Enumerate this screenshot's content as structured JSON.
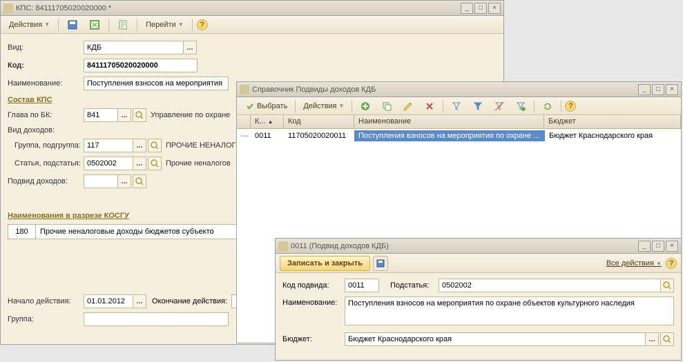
{
  "main_window": {
    "title": "КПС: 84111705020020000 *",
    "toolbar": {
      "actions": "Действия",
      "goto": "Перейти"
    },
    "fields": {
      "vid_label": "Вид:",
      "vid_value": "КДБ",
      "kod_label": "Код:",
      "kod_value": "84111705020020000",
      "naim_label": "Наименование:",
      "naim_value": "Поступления взносов на мероприятия"
    },
    "section_sostav": "Состав КПС",
    "glava_label": "Глава по БК:",
    "glava_value": "841",
    "glava_desc": "Управление по охране",
    "vid_dohodov_label": "Вид доходов:",
    "gruppa_label": "Группа, подгруппа:",
    "gruppa_value": "117",
    "gruppa_desc": "ПРОЧИЕ НЕНАЛОГ",
    "statya_label": "Статья, подстатья:",
    "statya_value": "0502002",
    "statya_desc": "Прочие неналогов",
    "podvid_label": "Подвид доходов:",
    "podvid_value": "",
    "section_kosgu": "Наименования в разрезе КОСГУ",
    "kosgu_code": "180",
    "kosgu_text": "Прочие неналоговые доходы бюджетов субъекто",
    "nachalo_label": "Начало действия:",
    "nachalo_value": "01.01.2012",
    "okonch_label": "Окончание действия:",
    "okonch_value": "",
    "group_label": "Группа:"
  },
  "dir_window": {
    "title": "Справочник Подвиды доходов КДБ",
    "select_btn": "Выбрать",
    "actions": "Действия",
    "columns": {
      "k": "К...",
      "kod": "Код",
      "naim": "Наименование",
      "budget": "Бюджет"
    },
    "row": {
      "k": "0011",
      "kod": "11705020020011",
      "naim": "Поступления взносов на мероприятия по охране ...",
      "budget": "Бюджет Краснодарского края"
    }
  },
  "sub_window": {
    "title": "0011 (Подвид доходов КДБ)",
    "save_close": "Записать и закрыть",
    "all_actions": "Все действия",
    "kod_podvida_label": "Код подвида:",
    "kod_podvida_value": "0011",
    "podstatya_label": "Подстатья:",
    "podstatya_value": "0502002",
    "naim_label": "Наименование:",
    "naim_value": "Поступления взносов на мероприятия по охране объектов культурного наследия",
    "budget_label": "Бюджет:",
    "budget_value": "Бюджет Краснодарского края"
  }
}
